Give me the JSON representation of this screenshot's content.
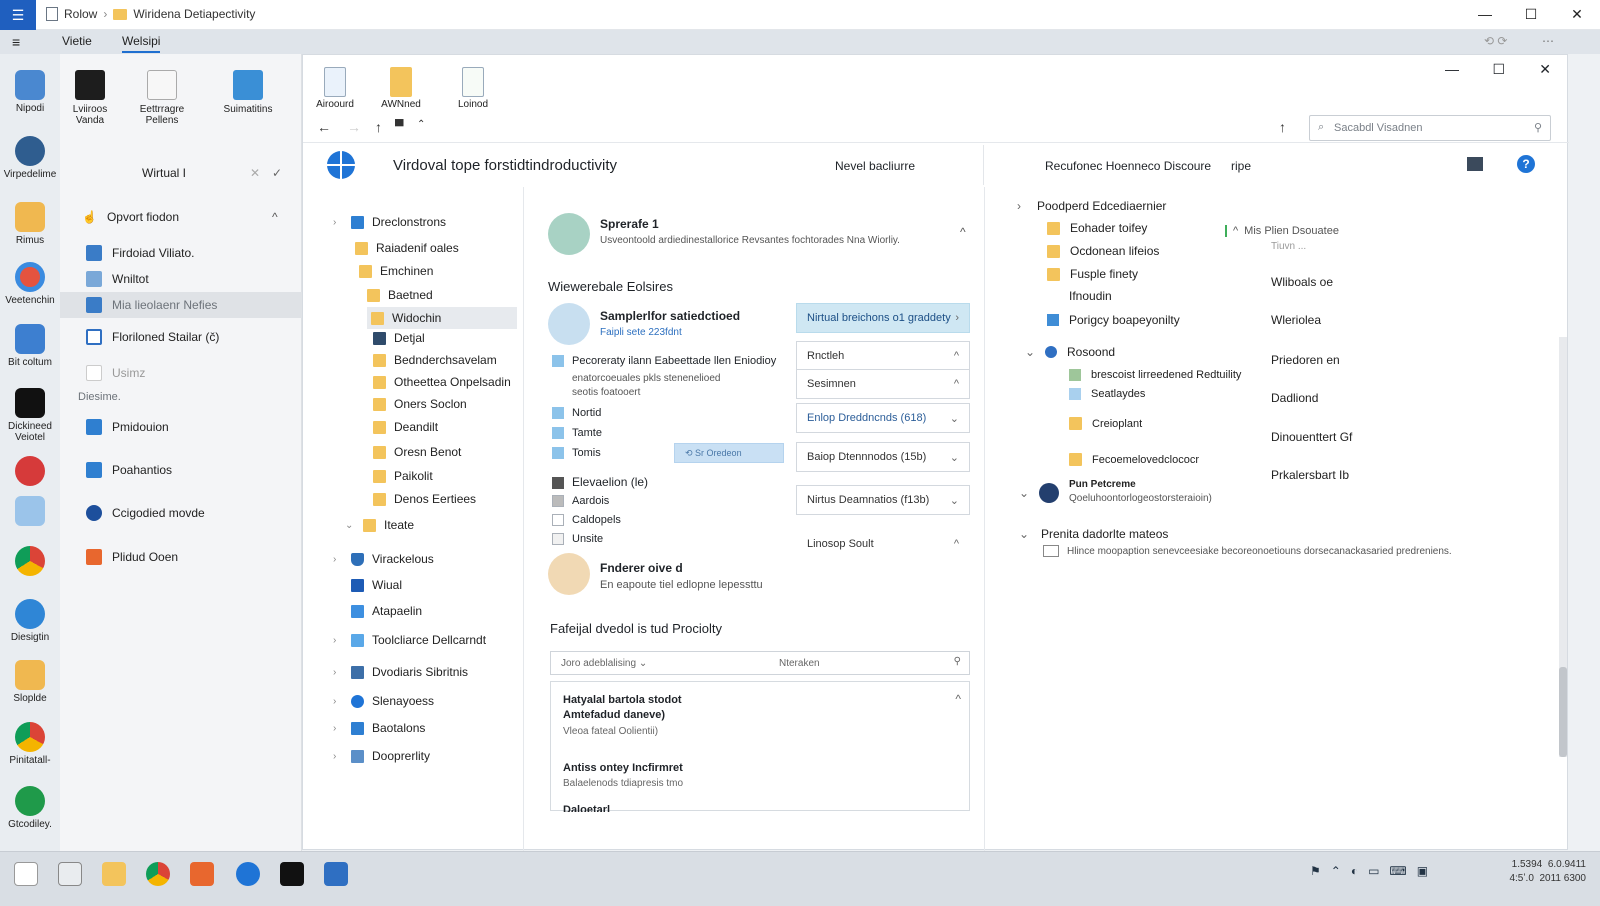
{
  "titlebar": {
    "menu_icon": "hamburger-icon",
    "crumb_root": "Rolow",
    "crumb_sep": "›",
    "crumb_folder": "Wiridena Detiapectivity",
    "min": "—",
    "max": "☐",
    "close": "✕"
  },
  "tabs": {
    "t1": "Vietie",
    "t2": "Welsipi"
  },
  "sidebar": {
    "apps": [
      "Nipodi",
      "Virpedelime",
      "Rimus",
      "Veetenchin",
      "Bit coltum",
      "Dickineed Veiotel",
      "",
      "",
      "",
      "Diesigtin",
      "Sloplde",
      "Pinitatall-",
      "Gtcodiley."
    ]
  },
  "leftpane": {
    "top_items": [
      {
        "label": "Lviiroos Vanda",
        "icon": "terminal-icon"
      },
      {
        "label": "Eettrragre Pellens",
        "icon": "document-icon"
      },
      {
        "label": "Suimatitins",
        "icon": "image-icon"
      }
    ],
    "section_title": "Wirtual I",
    "group_title": "Opvort fiodon",
    "items": [
      "Firdoiad Viliato.",
      "Wniltot",
      "Mia lieolaenr Nefies",
      "Floriloned Stailar (č)"
    ],
    "disabled_item": "Usimz",
    "subhead": "Diesime.",
    "lower_items": [
      "Pmidouion",
      "Poahantios",
      "Ccigodied movde",
      "Plidud Ooen"
    ]
  },
  "toolbar": {
    "tools": [
      "Airoourd",
      "AWNned",
      "Loinod"
    ]
  },
  "search": {
    "placeholder": "Sacabdl Visadnen"
  },
  "header": {
    "title": "Virdoval tope forstidtindroductivity",
    "sub_action": "Nevel bacliurre",
    "right_title": "Recufonec Hoenneco Discoure",
    "right_sub": "ripe"
  },
  "tree": {
    "items": [
      {
        "label": "Dreclonstrons",
        "kind": "blue",
        "chev": "›"
      },
      {
        "label": "Raiadenif oales",
        "kind": "folder"
      },
      {
        "label": "Emchinen",
        "kind": "folder"
      },
      {
        "label": "Baetned",
        "kind": "folder"
      },
      {
        "label": "Widochin",
        "kind": "folder"
      },
      {
        "label": "Detjal",
        "kind": "doc"
      },
      {
        "label": "Bednderchsavelam",
        "kind": "folder"
      },
      {
        "label": "Otheettea Onpelsadin",
        "kind": "folder"
      },
      {
        "label": "Oners Soclon",
        "kind": "folder"
      },
      {
        "label": "Deandilt",
        "kind": "folder"
      },
      {
        "label": "Oresn Benot",
        "kind": "folder"
      },
      {
        "label": "Paikolit",
        "kind": "folder"
      },
      {
        "label": "Denos Eertiees",
        "kind": "folder"
      },
      {
        "label": "Iteate",
        "kind": "folder"
      },
      {
        "label": "Virackelous",
        "kind": "shield"
      },
      {
        "label": "Wiual",
        "kind": "blue"
      },
      {
        "label": "Atapaelin",
        "kind": "blue"
      },
      {
        "label": "Toolcliarce Dellcarndt",
        "kind": "blue"
      },
      {
        "label": "Dvodiaris Sibritnis",
        "kind": "blue"
      },
      {
        "label": "Slenayoess",
        "kind": "blue"
      },
      {
        "label": "Baotalons",
        "kind": "blue"
      },
      {
        "label": "Dooprerlity",
        "kind": "blue"
      }
    ]
  },
  "center": {
    "card1": {
      "title": "Sprerafe 1",
      "desc": "Usveontoold ardiedinestallorice Revsantes fochtorades Nna Wiorliy."
    },
    "section1": "Wiewerebale Eolsires",
    "card2": {
      "title": "Samplerlfor satiedctioed",
      "sub": "Faipli sete 223fdnt"
    },
    "items": [
      "Pecoreraty ilann Eabeettade llen Eniodioy",
      "enatorcoeuales pkls stenenelioed",
      "seotis foatooert",
      "Nortid",
      "Tamte",
      "Tomis"
    ],
    "small_btn": "Sr Oredeon",
    "checks": [
      "Elevaelion (le)",
      "Aardois",
      "Caldopels",
      "Unsite"
    ],
    "card3": {
      "title": "Fnderer oive d",
      "desc": "En eapoute tiel edlopne lepessttu"
    },
    "section2": "Fafeijal dvedol is tud Prociolty",
    "filter": {
      "left": "Joro adeblalising ⌄",
      "right": "Nteraken"
    },
    "list": [
      {
        "title": "Hatyalal bartola stodot",
        "title2": "Amtefadud daneve)",
        "sub": "Vleoa fateal Oolientii)"
      },
      {
        "title": "Antiss ontey Incfirmret",
        "sub": "Balaelenods tdiapresis tmo"
      },
      {
        "title": "Daloetarl",
        "sub": ""
      }
    ],
    "buttons": [
      {
        "label": "Nirtual breichons o1 graddety",
        "hl": true,
        "chv": "›"
      },
      {
        "label": "Rnctleh",
        "chv": "^"
      },
      {
        "label": "Sesimnen",
        "chv": "^"
      },
      {
        "label": "Enlop Dreddncnds (618)",
        "chv": "⌄"
      },
      {
        "label": "Baiop Dtennnodos (15b)",
        "chv": "⌄"
      },
      {
        "label": "Nirtus Deamnatios (f13b)",
        "chv": "⌄"
      },
      {
        "label": "Linosop Soult",
        "chv": "^"
      }
    ]
  },
  "right": {
    "group1": "Poodperd Edcediaernier",
    "g1_items": [
      "Eohader toifey",
      "Ocdonean lifeios",
      "Fusple finety",
      "Ifnoudin"
    ],
    "item_special": "Porigcy boapeyonilty",
    "group2": "Rosoond",
    "g2_items": [
      "brescoist lirreedened Redtuility",
      "Seatlaydes",
      "Creioplant",
      "Fecoemelovedclococr"
    ],
    "aside_title": "Mis Plien Dsouatee",
    "aside_sub": "Tiuvn ...",
    "col_labels": [
      "Wliboals oe",
      "Wleriolea",
      "Priedoren en",
      "Dadliond",
      "Dinouenttert Gf",
      "Prkalersbart Ib"
    ],
    "user_title": "Pun Petcreme",
    "user_sub": "Qoeluhoontorlogeostorsteraioin)",
    "group3": "Prenita dadorlte mateos",
    "g3_desc": "Hlince moopaption senevceesiake becoreonoetiouns dorsecanackasaried predreniens."
  },
  "taskbar": {
    "tray_time": "1.5394",
    "tray_time2": "6.0.9411",
    "tray_date": "4:5ʼ.0",
    "tray_date2": "2011 6300"
  }
}
